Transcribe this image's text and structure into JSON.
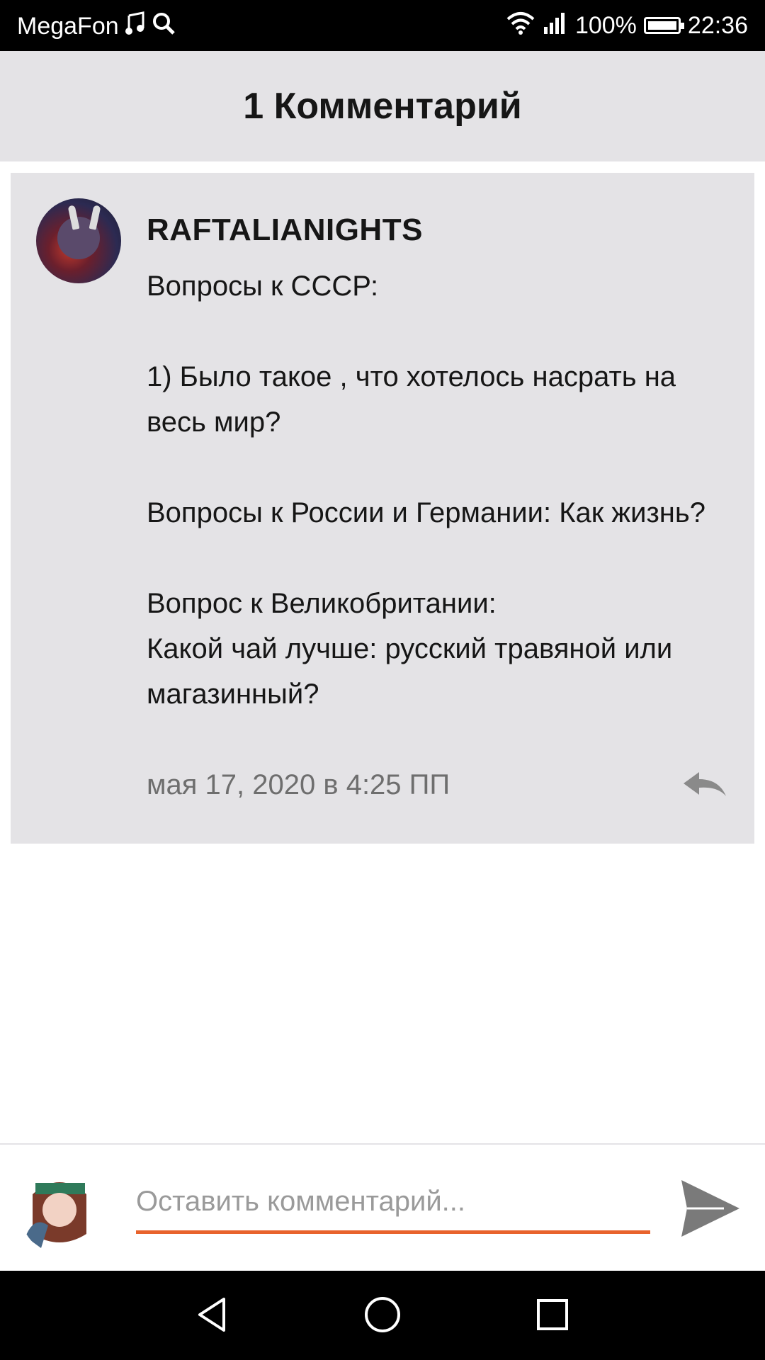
{
  "status_bar": {
    "carrier": "MegaFon",
    "battery": "100%",
    "time": "22:36",
    "icons": [
      "music-note-icon",
      "search-icon",
      "wifi-icon",
      "signal-icon",
      "battery-icon"
    ]
  },
  "header": {
    "title": "1 Комментарий"
  },
  "comment": {
    "username": "RAFTALIANIGHTS",
    "lines": [
      "Вопросы к СССР:",
      "",
      "1) Было такое , что хотелось насрать на весь мир?",
      "",
      "Вопросы к России и Германии: Как жизнь?",
      "",
      "Вопрос к Великобритании:",
      "Какой чай лучше: русский травяной или магазинный?"
    ],
    "timestamp": "мая 17, 2020 в 4:25 ПП",
    "reply_icon": "reply-icon"
  },
  "input": {
    "placeholder": "Оставить комментарий...",
    "send_icon": "send-icon"
  },
  "colors": {
    "accent": "#e8632c",
    "card_background": "#e4e3e6",
    "text": "#161616",
    "muted": "#6e6e6e"
  }
}
